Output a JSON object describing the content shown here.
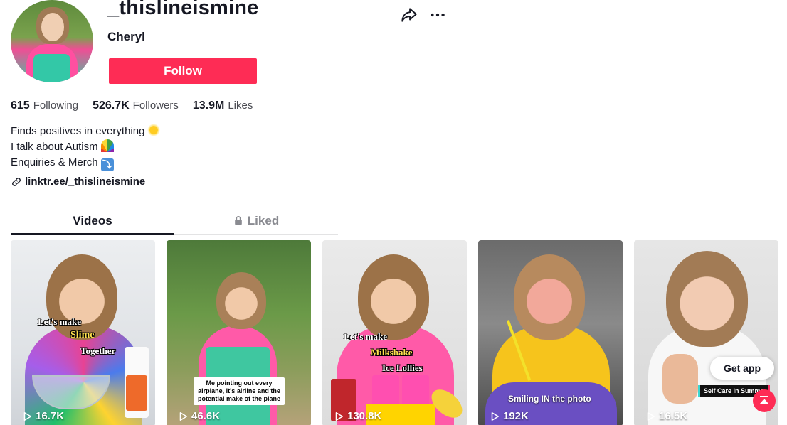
{
  "profile": {
    "username": "_thislineismine",
    "nickname": "Cheryl",
    "follow_label": "Follow"
  },
  "stats": [
    {
      "value": "615",
      "label": "Following"
    },
    {
      "value": "526.7K",
      "label": "Followers"
    },
    {
      "value": "13.9M",
      "label": "Likes"
    }
  ],
  "bio": {
    "lines": [
      "Finds positives in everything",
      "I talk about Autism",
      "Enquiries & Merch"
    ],
    "emoji_icons": [
      "sun-icon",
      "rainbow-icon",
      "down-arrow-box-icon"
    ]
  },
  "link": "linktr.ee/_thislineismine",
  "tabs": [
    {
      "label": "Videos",
      "active": true
    },
    {
      "label": "Liked",
      "active": false,
      "locked": true
    }
  ],
  "videos": [
    {
      "views": "16.7K",
      "overlay": [
        "Let's make",
        "Slime",
        "Together"
      ]
    },
    {
      "views": "46.6K",
      "caption": "Me pointing out every airplane, it's airline and the potential make of the plane"
    },
    {
      "views": "130.8K",
      "overlay": [
        "Let's make",
        "Milkshake",
        "Ice Lollies"
      ]
    },
    {
      "views": "192K",
      "caption": "Smiling IN the photo"
    },
    {
      "views": "16.5K",
      "caption": "Self Care in Summe"
    }
  ],
  "floating": {
    "get_app_label": "Get app"
  },
  "colors": {
    "accent": "#fe2c55",
    "text": "#161823"
  }
}
